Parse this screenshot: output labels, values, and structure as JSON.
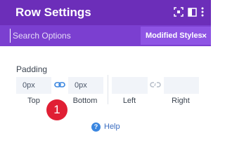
{
  "header": {
    "title": "Row Settings"
  },
  "icons": {
    "header": [
      "focus-icon",
      "split-view-icon",
      "more-vertical-icon"
    ],
    "link": "link-icon",
    "unlink": "unlink-icon",
    "help": "help-icon"
  },
  "colors": {
    "header_bg": "#6c2eb9",
    "search_bg": "#7b3fd0",
    "badge": "#e01f34",
    "help": "#3a6cbf"
  },
  "search": {
    "placeholder": "Search Options",
    "value": ""
  },
  "modified_styles": {
    "label": "Modified Styles",
    "close": "×"
  },
  "padding": {
    "label": "Padding",
    "fields": [
      {
        "label": "Top",
        "value": "0px"
      },
      {
        "label": "Bottom",
        "value": "0px"
      },
      {
        "label": "Left",
        "value": ""
      },
      {
        "label": "Right",
        "value": ""
      }
    ]
  },
  "badge": {
    "value": "1"
  },
  "help": {
    "label": "Help",
    "icon_glyph": "?"
  }
}
